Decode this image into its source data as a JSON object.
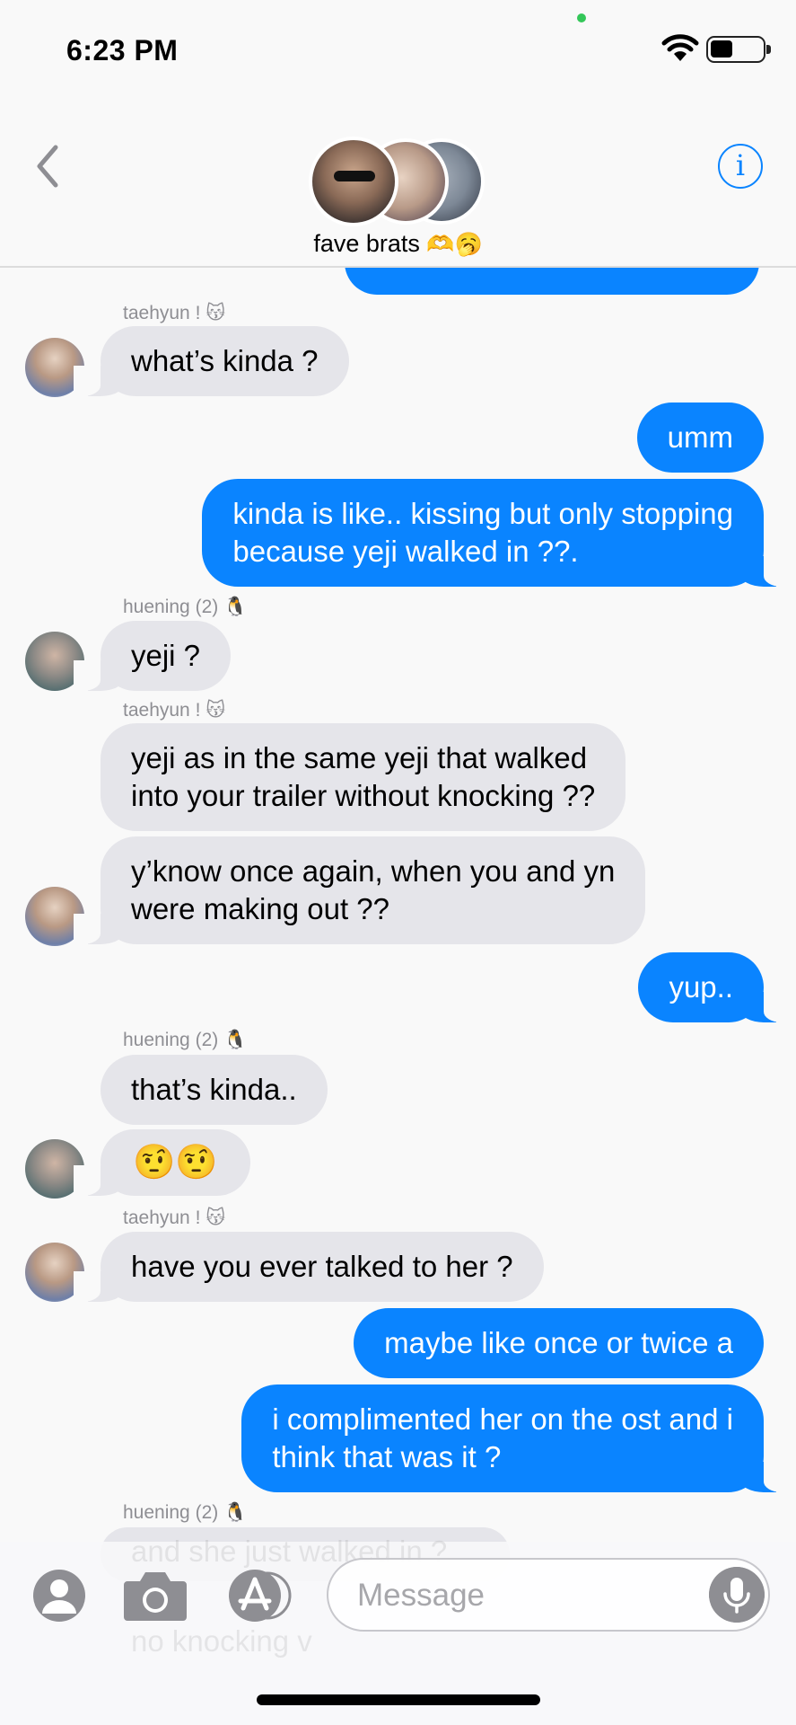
{
  "status": {
    "time": "6:23 PM"
  },
  "header": {
    "group_name": "fave brats",
    "group_emoji": "🫶🥱"
  },
  "messages": [
    {
      "sender": "taehyun ! 😽",
      "text": "what’s kinda ?"
    },
    {
      "text": "umm"
    },
    {
      "text": "kinda is like.. kissing but only stopping\nbecause yeji walked in ??."
    },
    {
      "sender": "huening (2) 🐧",
      "text": "yeji ?"
    },
    {
      "sender": "taehyun ! 😽",
      "text": "yeji as in the same yeji that walked\ninto your trailer without knocking ??"
    },
    {
      "text": "y’know once again, when you and yn\nwere making out ??"
    },
    {
      "text": "yup.."
    },
    {
      "sender": "huening (2) 🐧",
      "text": "that’s kinda.."
    },
    {
      "text": "🤨🤨"
    },
    {
      "sender": "taehyun ! 😽",
      "text": "have you ever talked to her ?"
    },
    {
      "text": "maybe like once or twice a"
    },
    {
      "text": "i complimented her on the ost and i\nthink that was it ?"
    },
    {
      "sender": "huening (2) 🐧",
      "text": "and she just walked in ?"
    },
    {
      "text": "no knocking v"
    }
  ],
  "compose": {
    "placeholder": "Message"
  },
  "colors": {
    "outgoing": "#0a84ff",
    "incoming": "#e5e5ea",
    "accent": "#0a84ff"
  }
}
